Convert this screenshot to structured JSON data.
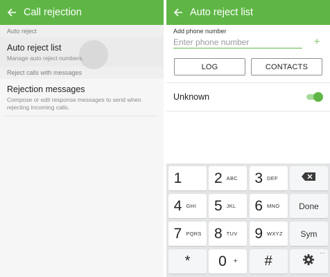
{
  "left": {
    "title": "Call rejection",
    "sections": [
      {
        "header": "Auto reject",
        "title": "Auto reject list",
        "subtitle": "Manage auto reject numbers."
      },
      {
        "header": "Reject calls with messages",
        "title": "Rejection messages",
        "subtitle": "Compose or edit response messages to send when rejecting incoming calls."
      }
    ]
  },
  "right": {
    "title": "Auto reject list",
    "add_label": "Add phone number",
    "phone_placeholder": "Enter phone number",
    "phone_value": "",
    "buttons": {
      "log": "LOG",
      "contacts": "CONTACTS"
    },
    "unknown_label": "Unknown",
    "unknown_enabled": true
  },
  "keyboard": {
    "keys": [
      [
        {
          "num": "1",
          "letters": ""
        },
        {
          "num": "2",
          "letters": "ABC"
        },
        {
          "num": "3",
          "letters": "DEF"
        },
        {
          "icon": "backspace-icon"
        }
      ],
      [
        {
          "num": "4",
          "letters": "GHI"
        },
        {
          "num": "5",
          "letters": "JKL"
        },
        {
          "num": "6",
          "letters": "MNO"
        },
        {
          "label": "Done"
        }
      ],
      [
        {
          "num": "7",
          "letters": "PQRS"
        },
        {
          "num": "8",
          "letters": "TUV"
        },
        {
          "num": "9",
          "letters": "WXYZ"
        },
        {
          "label": "Sym"
        }
      ],
      [
        {
          "sym": "*"
        },
        {
          "num": "0",
          "extra": "+"
        },
        {
          "sym": "#"
        },
        {
          "icon": "settings-icon"
        }
      ]
    ]
  },
  "colors": {
    "accent": "#5fb646",
    "toggle_track": "#a7d99a",
    "keyboard_bg": "#e2e4e6"
  }
}
